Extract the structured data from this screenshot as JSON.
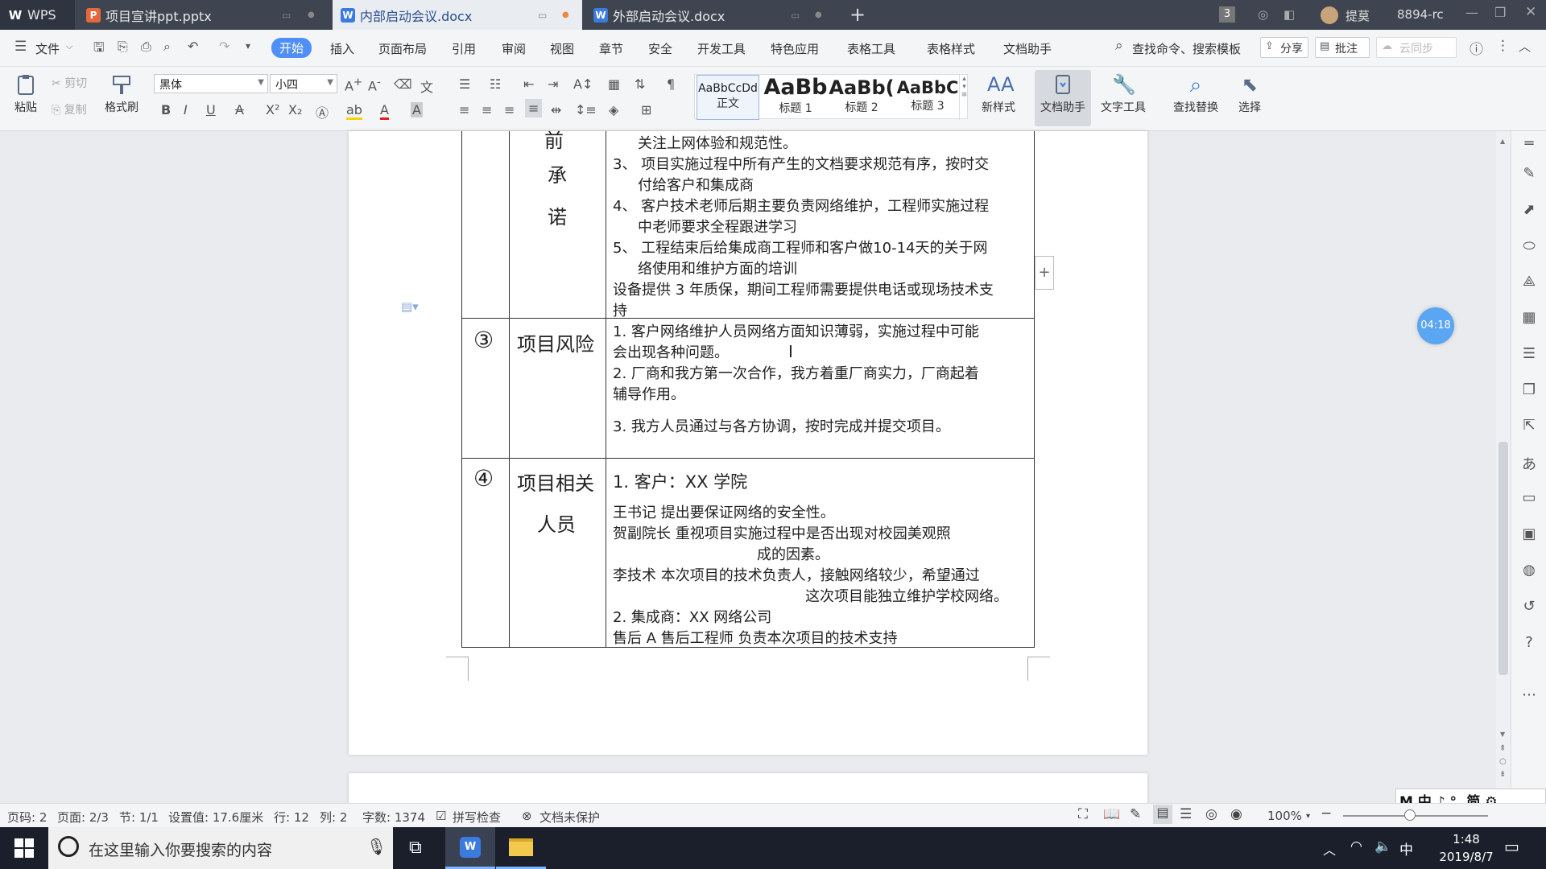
{
  "titlebar": {
    "app": "WPS",
    "tabs": [
      {
        "label": "项目宣讲ppt.pptx",
        "icon": "ppt-icon",
        "color": "#e4673d"
      },
      {
        "label": "内部启动会议.docx",
        "icon": "word-icon",
        "color": "#3b7be0"
      },
      {
        "label": "外部启动会议.docx",
        "icon": "word-icon",
        "color": "#3b7be0"
      }
    ],
    "new_tab": "+",
    "badge": "3",
    "user": "提莫",
    "user_id": "8894-rc"
  },
  "menu": {
    "file": "文件",
    "items": [
      "开始",
      "插入",
      "页面布局",
      "引用",
      "审阅",
      "视图",
      "章节",
      "安全",
      "开发工具",
      "特色应用",
      "表格工具",
      "表格样式",
      "文档助手"
    ],
    "search": "查找命令、搜索模板",
    "share": "分享",
    "comment": "批注",
    "cloud": "云同步"
  },
  "ribbon": {
    "paste": "粘贴",
    "cut": "剪切",
    "copy": "复制",
    "format_painter": "格式刷",
    "font_name": "黑体",
    "font_size": "小四",
    "styles": [
      {
        "preview": "AaBbCcDd",
        "label": "正文"
      },
      {
        "preview": "AaBb",
        "label": "标题 1"
      },
      {
        "preview": "AaBb(",
        "label": "标题 2"
      },
      {
        "preview": "AaBbC",
        "label": "标题 3"
      }
    ],
    "new_style": "新样式",
    "doc_assistant": "文档助手",
    "text_tools": "文字工具",
    "find_replace": "查找替换",
    "select": "选择"
  },
  "document": {
    "commitment_chars": [
      "前",
      "承",
      "诺"
    ],
    "commitment_lines": [
      "关注上网体验和规范性。",
      "3、 项目实施过程中所有产生的文档要求规范有序，按时交",
      "付给客户和集成商",
      "4、 客户技术老师后期主要负责网络维护，工程师实施过程",
      "中老师要求全程跟进学习",
      "5、 工程结束后给集成商工程师和客户做10-14天的关于网",
      "络使用和维护方面的培训",
      "设备提供 3 年质保，期间工程师需要提供电话或现场技术支",
      "持"
    ],
    "risk_num": "③",
    "risk_title": "项目风险",
    "risk_lines": [
      "1. 客户网络维护人员网络方面知识薄弱，实施过程中可能",
      "会出现各种问题。",
      "2. 厂商和我方第一次合作，我方着重厂商实力，厂商起着",
      "辅导作用。",
      "3. 我方人员通过与各方协调，按时完成并提交项目。"
    ],
    "people_num": "④",
    "people_title_1": "项目相关",
    "people_title_2": "人员",
    "people_lines": [
      "1. 客户：XX 学院",
      "王书记     提出要保证网络的安全性。",
      "贺副院长      重视项目实施过程中是否出现对校园美观照",
      "成的因素。",
      "李技术   本次项目的技术负责人，接触网络较少，希望通过",
      "这次项目能独立维护学校网络。",
      "2. 集成商：XX 网络公司",
      "售后 A   售后工程师    负责本次项目的技术支持"
    ]
  },
  "timer": "04:18",
  "status": {
    "page_num": "页码: 2",
    "page": "页面: 2/3",
    "section": "节: 1/1",
    "setting": "设置值: 17.6厘米",
    "row": "行: 12",
    "col": "列: 2",
    "words": "字数: 1374",
    "spell": "拼写检查",
    "protect": "文档未保护",
    "zoom": "100%"
  },
  "ime": "M 中 ♪ °, 简 ⚙",
  "taskbar": {
    "search_placeholder": "在这里输入你要搜索的内容",
    "ime": "中",
    "time": "1:48",
    "date": "2019/8/7"
  }
}
